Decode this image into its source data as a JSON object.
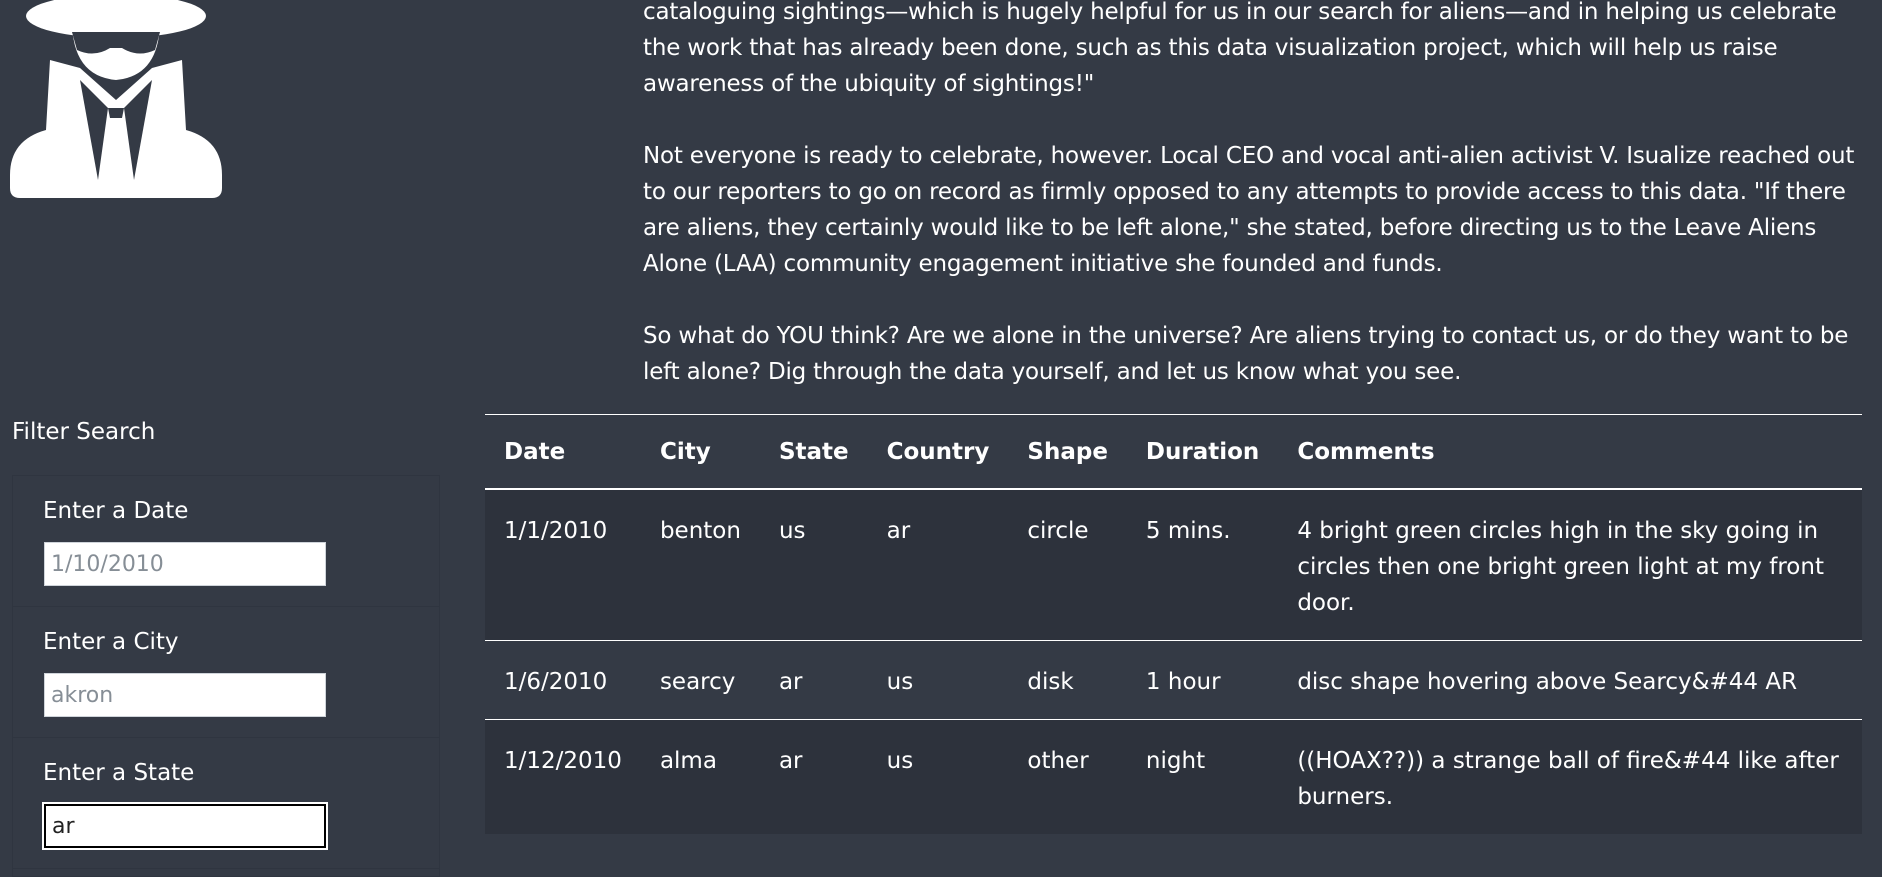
{
  "icons": {
    "logo": "spy-icon"
  },
  "article": {
    "paragraphs": [
      "cataloguing sightings—which is hugely helpful for us in our search for aliens—and in helping us celebrate the work that has already been done, such as this data visualization project, which will help us raise awareness of the ubiquity of sightings!\"",
      "Not everyone is ready to celebrate, however. Local CEO and vocal anti-alien activist V. Isualize reached out to our reporters to go on record as firmly opposed to any attempts to provide access to this data. \"If there are aliens, they certainly would like to be left alone,\" she stated, before directing us to the Leave Aliens Alone (LAA) community engagement initiative she founded and funds.",
      "So what do YOU think? Are we alone in the universe? Are aliens trying to contact us, or do they want to be left alone? Dig through the data yourself, and let us know what you see."
    ]
  },
  "filters": {
    "title": "Filter Search",
    "date": {
      "label": "Enter a Date",
      "placeholder": "1/10/2010",
      "value": ""
    },
    "city": {
      "label": "Enter a City",
      "placeholder": "akron",
      "value": ""
    },
    "state": {
      "label": "Enter a State",
      "placeholder": "",
      "value": "ar"
    }
  },
  "table": {
    "headers": [
      "Date",
      "City",
      "State",
      "Country",
      "Shape",
      "Duration",
      "Comments"
    ],
    "rows": [
      [
        "1/1/2010",
        "benton",
        "us",
        "ar",
        "circle",
        "5 mins.",
        "4 bright green circles high in the sky going in circles then one bright green light at my front door."
      ],
      [
        "1/6/2010",
        "searcy",
        "ar",
        "us",
        "disk",
        "1 hour",
        "disc shape hovering above Searcy&#44 AR"
      ],
      [
        "1/12/2010",
        "alma",
        "ar",
        "us",
        "other",
        "night",
        "((HOAX??)) a strange ball of fire&#44 like after burners."
      ]
    ]
  },
  "colors": {
    "background": "#343a45",
    "stripe": "#2d323c",
    "text": "#ffffff"
  }
}
